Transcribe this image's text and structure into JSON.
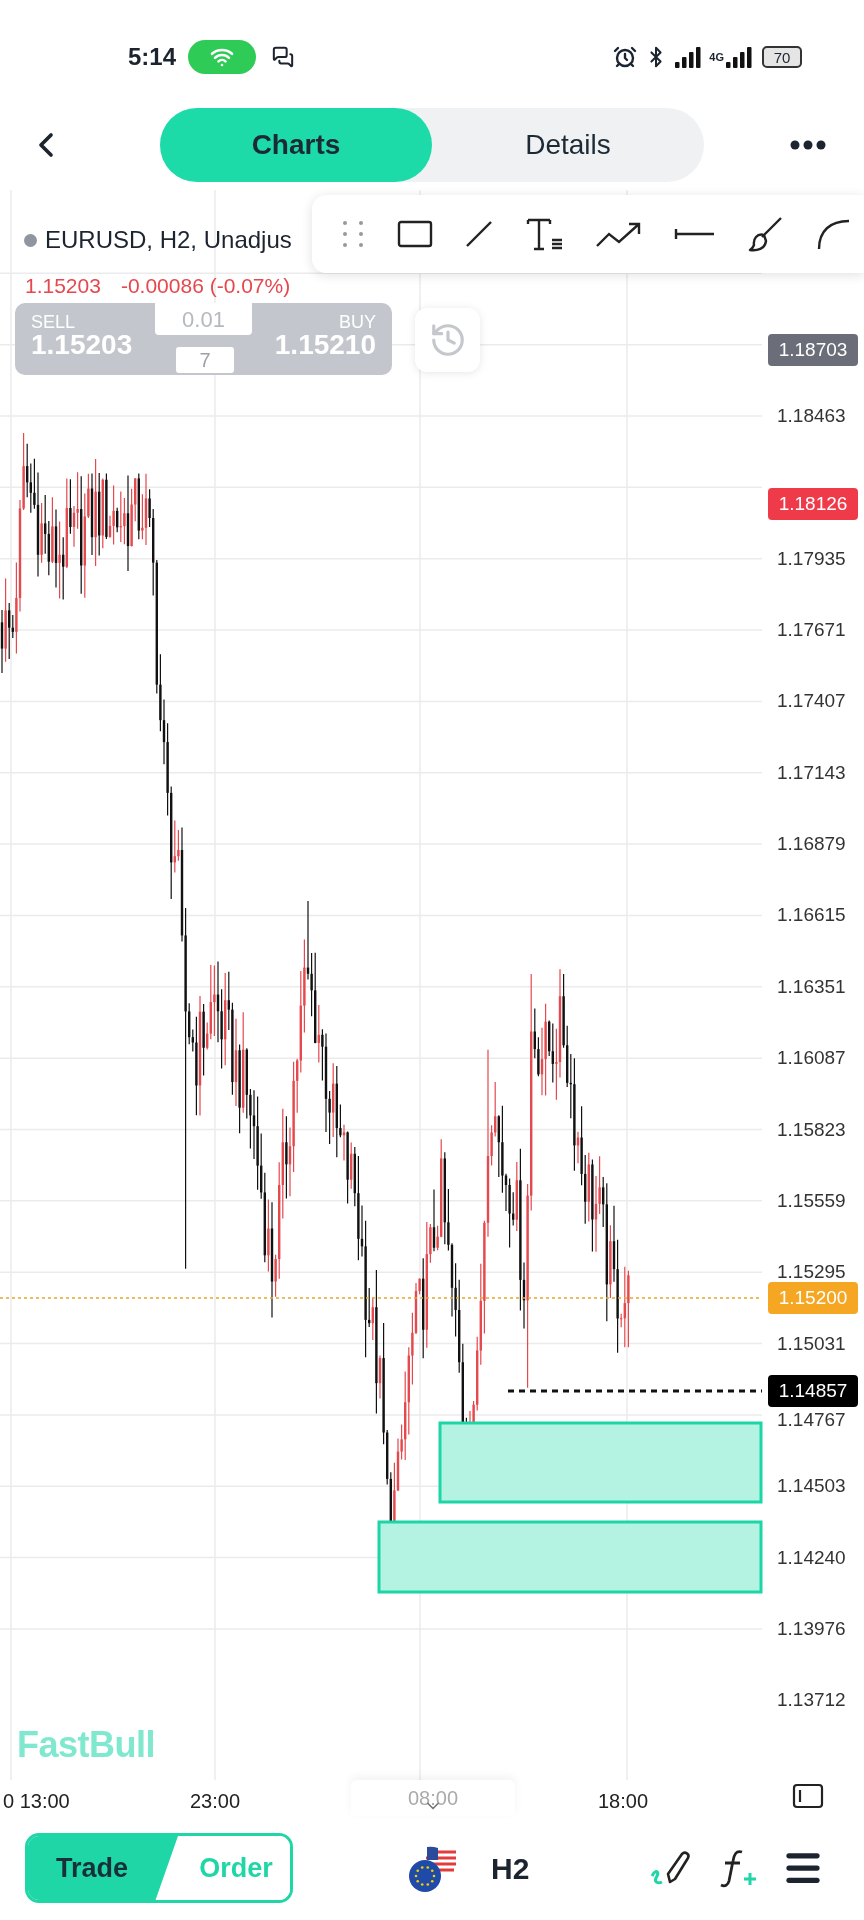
{
  "status_bar": {
    "time": "5:14",
    "network": "4G",
    "battery": "70"
  },
  "header": {
    "tabs": [
      {
        "label": "Charts",
        "selected": true
      },
      {
        "label": "Details",
        "selected": false
      }
    ]
  },
  "chart": {
    "symbol": "EURUSD, H2, Unadjus",
    "last_price": "1.15203",
    "change": "-0.00086 (-0.07%)",
    "trade_panel": {
      "sell_label": "SELL",
      "sell_price": "1.15203",
      "lot": "0.01",
      "spread": "7",
      "buy_label": "BUY",
      "buy_price": "1.15210"
    },
    "price_axis": [
      "1.18463",
      "1.17935",
      "1.17671",
      "1.17407",
      "1.17143",
      "1.16879",
      "1.16615",
      "1.16351",
      "1.16087",
      "1.15823",
      "1.15559",
      "1.15295",
      "1.15031",
      "1.14767",
      "1.14503",
      "1.14240",
      "1.13976",
      "1.13712"
    ],
    "price_badges": [
      {
        "text": "1.18703",
        "color": "#6b6e78"
      },
      {
        "text": "1.18126",
        "color": "#ef3a4a"
      },
      {
        "text": "1.15200",
        "color": "#f5a623"
      },
      {
        "text": "1.14857",
        "color": "#000000"
      }
    ],
    "logo": "FastBull",
    "time_axis": [
      {
        "label": "0 13:00",
        "highlighted": false
      },
      {
        "label": "23:00",
        "highlighted": false
      },
      {
        "label": "08:00",
        "highlighted": true
      },
      {
        "label": "18:00",
        "highlighted": false
      }
    ]
  },
  "bottom_bar": {
    "modes": [
      {
        "label": "Trade",
        "selected": true
      },
      {
        "label": "Order",
        "selected": false
      }
    ],
    "timeframe": "H2"
  }
}
